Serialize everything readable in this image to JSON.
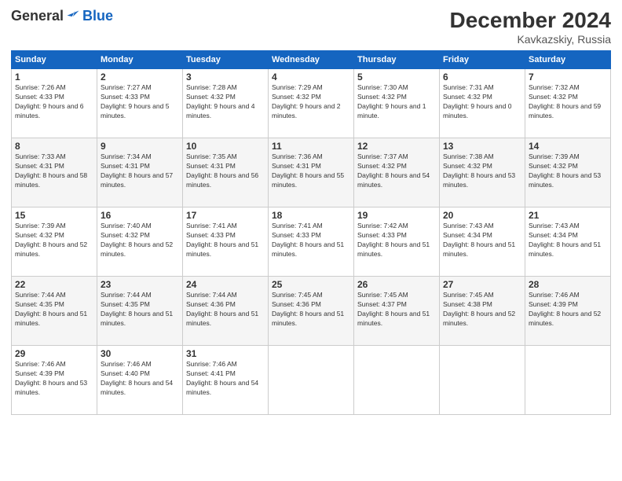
{
  "header": {
    "logo_general": "General",
    "logo_blue": "Blue",
    "month": "December 2024",
    "location": "Kavkazskiy, Russia"
  },
  "weekdays": [
    "Sunday",
    "Monday",
    "Tuesday",
    "Wednesday",
    "Thursday",
    "Friday",
    "Saturday"
  ],
  "weeks": [
    [
      {
        "day": "1",
        "sunrise": "7:26 AM",
        "sunset": "4:33 PM",
        "daylight": "9 hours and 6 minutes."
      },
      {
        "day": "2",
        "sunrise": "7:27 AM",
        "sunset": "4:33 PM",
        "daylight": "9 hours and 5 minutes."
      },
      {
        "day": "3",
        "sunrise": "7:28 AM",
        "sunset": "4:32 PM",
        "daylight": "9 hours and 4 minutes."
      },
      {
        "day": "4",
        "sunrise": "7:29 AM",
        "sunset": "4:32 PM",
        "daylight": "9 hours and 2 minutes."
      },
      {
        "day": "5",
        "sunrise": "7:30 AM",
        "sunset": "4:32 PM",
        "daylight": "9 hours and 1 minute."
      },
      {
        "day": "6",
        "sunrise": "7:31 AM",
        "sunset": "4:32 PM",
        "daylight": "9 hours and 0 minutes."
      },
      {
        "day": "7",
        "sunrise": "7:32 AM",
        "sunset": "4:32 PM",
        "daylight": "8 hours and 59 minutes."
      }
    ],
    [
      {
        "day": "8",
        "sunrise": "7:33 AM",
        "sunset": "4:31 PM",
        "daylight": "8 hours and 58 minutes."
      },
      {
        "day": "9",
        "sunrise": "7:34 AM",
        "sunset": "4:31 PM",
        "daylight": "8 hours and 57 minutes."
      },
      {
        "day": "10",
        "sunrise": "7:35 AM",
        "sunset": "4:31 PM",
        "daylight": "8 hours and 56 minutes."
      },
      {
        "day": "11",
        "sunrise": "7:36 AM",
        "sunset": "4:31 PM",
        "daylight": "8 hours and 55 minutes."
      },
      {
        "day": "12",
        "sunrise": "7:37 AM",
        "sunset": "4:32 PM",
        "daylight": "8 hours and 54 minutes."
      },
      {
        "day": "13",
        "sunrise": "7:38 AM",
        "sunset": "4:32 PM",
        "daylight": "8 hours and 53 minutes."
      },
      {
        "day": "14",
        "sunrise": "7:39 AM",
        "sunset": "4:32 PM",
        "daylight": "8 hours and 53 minutes."
      }
    ],
    [
      {
        "day": "15",
        "sunrise": "7:39 AM",
        "sunset": "4:32 PM",
        "daylight": "8 hours and 52 minutes."
      },
      {
        "day": "16",
        "sunrise": "7:40 AM",
        "sunset": "4:32 PM",
        "daylight": "8 hours and 52 minutes."
      },
      {
        "day": "17",
        "sunrise": "7:41 AM",
        "sunset": "4:33 PM",
        "daylight": "8 hours and 51 minutes."
      },
      {
        "day": "18",
        "sunrise": "7:41 AM",
        "sunset": "4:33 PM",
        "daylight": "8 hours and 51 minutes."
      },
      {
        "day": "19",
        "sunrise": "7:42 AM",
        "sunset": "4:33 PM",
        "daylight": "8 hours and 51 minutes."
      },
      {
        "day": "20",
        "sunrise": "7:43 AM",
        "sunset": "4:34 PM",
        "daylight": "8 hours and 51 minutes."
      },
      {
        "day": "21",
        "sunrise": "7:43 AM",
        "sunset": "4:34 PM",
        "daylight": "8 hours and 51 minutes."
      }
    ],
    [
      {
        "day": "22",
        "sunrise": "7:44 AM",
        "sunset": "4:35 PM",
        "daylight": "8 hours and 51 minutes."
      },
      {
        "day": "23",
        "sunrise": "7:44 AM",
        "sunset": "4:35 PM",
        "daylight": "8 hours and 51 minutes."
      },
      {
        "day": "24",
        "sunrise": "7:44 AM",
        "sunset": "4:36 PM",
        "daylight": "8 hours and 51 minutes."
      },
      {
        "day": "25",
        "sunrise": "7:45 AM",
        "sunset": "4:36 PM",
        "daylight": "8 hours and 51 minutes."
      },
      {
        "day": "26",
        "sunrise": "7:45 AM",
        "sunset": "4:37 PM",
        "daylight": "8 hours and 51 minutes."
      },
      {
        "day": "27",
        "sunrise": "7:45 AM",
        "sunset": "4:38 PM",
        "daylight": "8 hours and 52 minutes."
      },
      {
        "day": "28",
        "sunrise": "7:46 AM",
        "sunset": "4:39 PM",
        "daylight": "8 hours and 52 minutes."
      }
    ],
    [
      {
        "day": "29",
        "sunrise": "7:46 AM",
        "sunset": "4:39 PM",
        "daylight": "8 hours and 53 minutes."
      },
      {
        "day": "30",
        "sunrise": "7:46 AM",
        "sunset": "4:40 PM",
        "daylight": "8 hours and 54 minutes."
      },
      {
        "day": "31",
        "sunrise": "7:46 AM",
        "sunset": "4:41 PM",
        "daylight": "8 hours and 54 minutes."
      },
      null,
      null,
      null,
      null
    ]
  ],
  "labels": {
    "sunrise": "Sunrise:",
    "sunset": "Sunset:",
    "daylight": "Daylight:"
  }
}
